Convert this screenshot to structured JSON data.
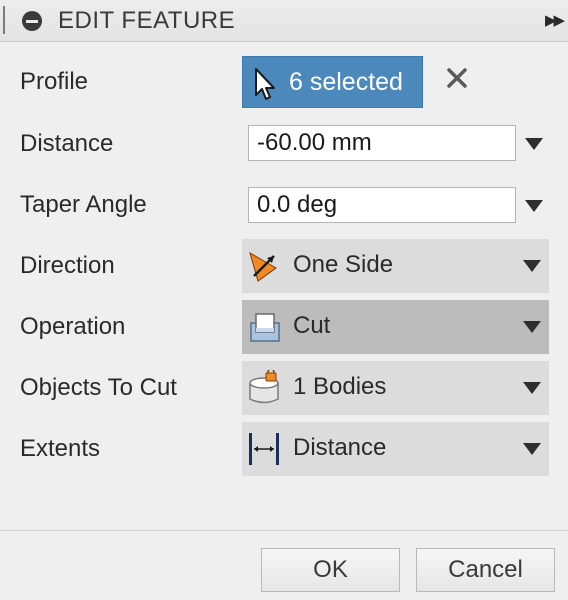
{
  "header": {
    "title": "EDIT FEATURE"
  },
  "fields": {
    "profile": {
      "label": "Profile",
      "value": "6 selected"
    },
    "distance": {
      "label": "Distance",
      "value": "-60.00 mm"
    },
    "taper_angle": {
      "label": "Taper Angle",
      "value": "0.0 deg"
    },
    "direction": {
      "label": "Direction",
      "value": "One Side",
      "icon": "one-side-icon"
    },
    "operation": {
      "label": "Operation",
      "value": "Cut",
      "icon": "cut-operation-icon"
    },
    "objects_to_cut": {
      "label": "Objects To Cut",
      "value": "1 Bodies",
      "icon": "body-lock-icon"
    },
    "extents": {
      "label": "Extents",
      "value": "Distance",
      "icon": "distance-extent-icon"
    }
  },
  "footer": {
    "ok_label": "OK",
    "cancel_label": "Cancel"
  },
  "colors": {
    "selection_blue": "#4b89bd",
    "direction_orange": "#f08a24"
  }
}
